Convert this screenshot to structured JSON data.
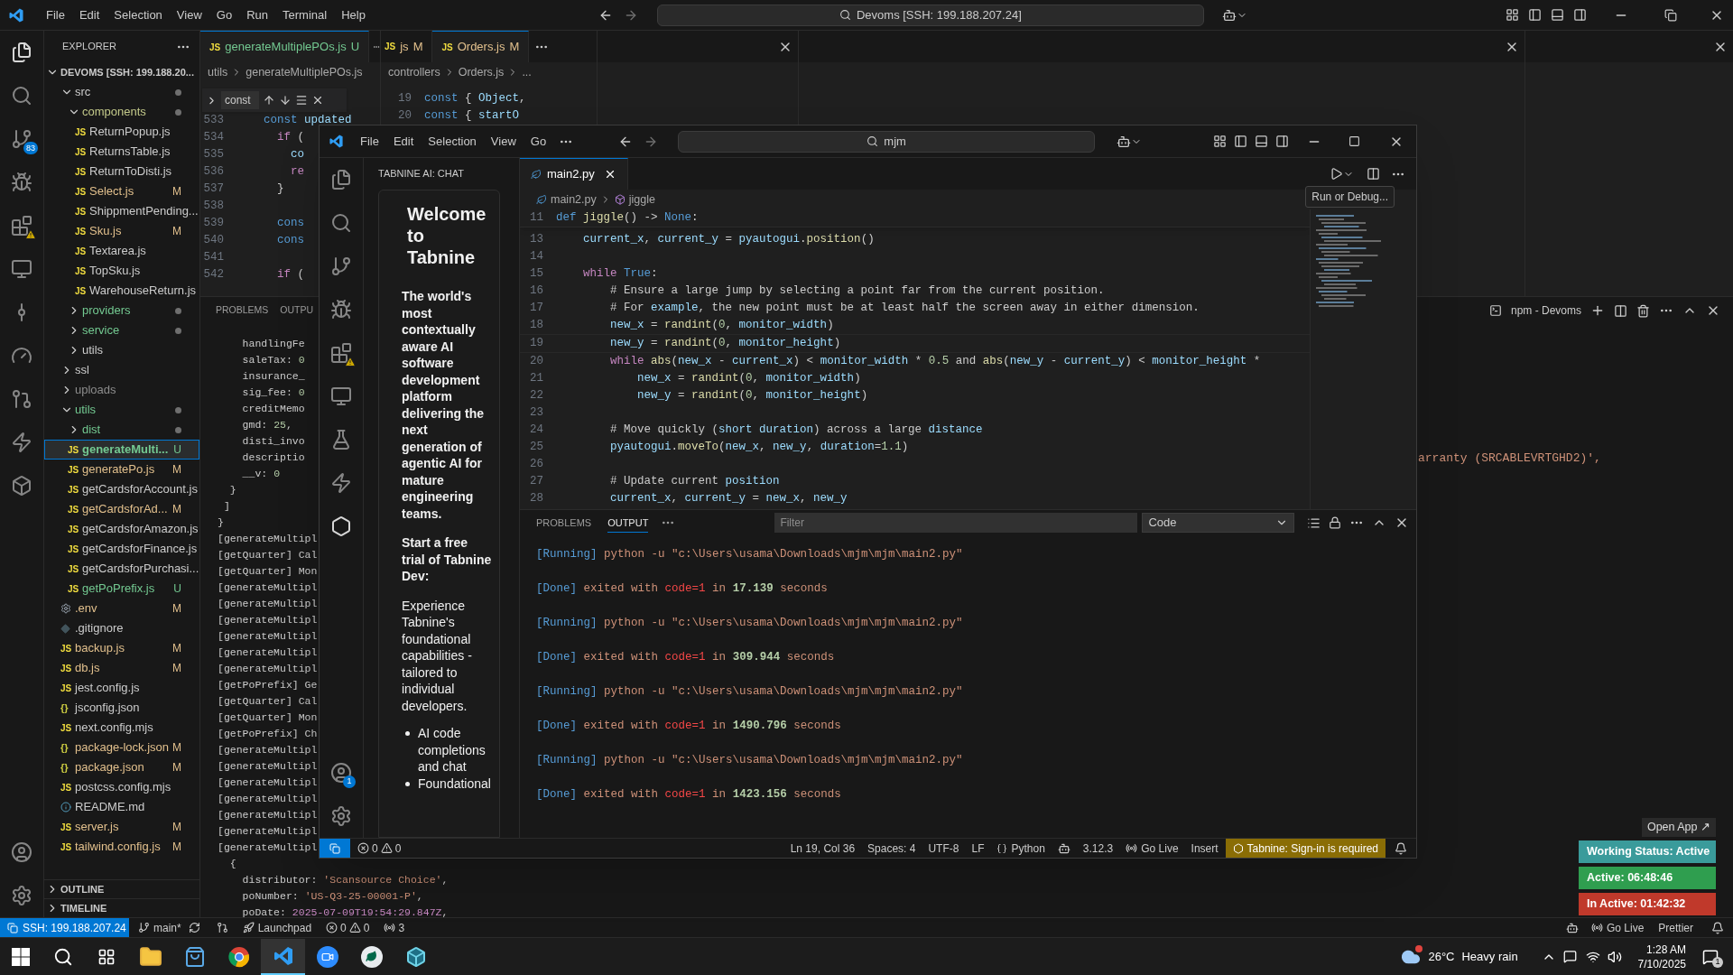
{
  "outer": {
    "menu": [
      "File",
      "Edit",
      "Selection",
      "View",
      "Go",
      "Run",
      "Terminal",
      "Help"
    ],
    "command_center": "Devoms [SSH: 199.188.207.24]",
    "source_control_badge": "83",
    "explorer": {
      "title": "EXPLORER",
      "root": "DEVOMS [SSH: 199.188.20...",
      "tree": [
        {
          "kind": "folder",
          "label": "src",
          "color": "#cccccc",
          "dot": true,
          "expanded": true,
          "selected": false,
          "children": [
            {
              "kind": "folder",
              "label": "components",
              "color": "#c3c98a",
              "dot": true,
              "expanded": true,
              "selected": false,
              "children": [
                {
                  "kind": "js",
                  "glyph": "JS",
                  "label": "ReturnPopup.js",
                  "color": "#cccccc",
                  "selected": false
                },
                {
                  "kind": "js",
                  "glyph": "JS",
                  "label": "ReturnsTable.js",
                  "color": "#cccccc",
                  "selected": false
                },
                {
                  "kind": "js",
                  "glyph": "JS",
                  "label": "ReturnToDisti.js",
                  "color": "#cccccc",
                  "selected": false
                },
                {
                  "kind": "js",
                  "glyph": "JS",
                  "label": "Select.js",
                  "badge": "M",
                  "color": "#e2c08d",
                  "selected": false
                },
                {
                  "kind": "js",
                  "glyph": "JS",
                  "label": "ShippmentPending...",
                  "color": "#cccccc",
                  "selected": false
                },
                {
                  "kind": "js",
                  "glyph": "JS",
                  "label": "Sku.js",
                  "badge": "M",
                  "color": "#e2c08d",
                  "selected": false
                },
                {
                  "kind": "js",
                  "glyph": "JS",
                  "label": "Textarea.js",
                  "color": "#cccccc",
                  "selected": false
                },
                {
                  "kind": "js",
                  "glyph": "JS",
                  "label": "TopSku.js",
                  "color": "#cccccc",
                  "selected": false
                },
                {
                  "kind": "js",
                  "glyph": "JS",
                  "label": "WarehouseReturn.js",
                  "color": "#cccccc",
                  "selected": false
                }
              ]
            },
            {
              "kind": "folder",
              "label": "providers",
              "color": "#73c991",
              "dot": true,
              "expanded": false,
              "selected": false
            },
            {
              "kind": "folder",
              "label": "service",
              "color": "#73c991",
              "dot": true,
              "expanded": false,
              "selected": false
            },
            {
              "kind": "folder",
              "label": "utils",
              "color": "#cccccc",
              "dot": false,
              "expanded": false,
              "selected": false
            }
          ]
        },
        {
          "kind": "folder",
          "label": "ssl",
          "color": "#cccccc",
          "dot": false,
          "expanded": false,
          "selected": false
        },
        {
          "kind": "folder",
          "label": "uploads",
          "color": "#8c8c8c",
          "dot": false,
          "expanded": false,
          "selected": false
        },
        {
          "kind": "folder",
          "label": "utils",
          "color": "#73c991",
          "dot": true,
          "expanded": true,
          "selected": false,
          "children": [
            {
              "kind": "folder",
              "label": "dist",
              "color": "#73c991",
              "dot": true,
              "expanded": false,
              "selected": false
            },
            {
              "kind": "js",
              "glyph": "JS",
              "label": "generateMulti...",
              "badge": "U",
              "color": "#73c991",
              "selected": true
            },
            {
              "kind": "js",
              "glyph": "JS",
              "label": "generatePo.js",
              "badge": "M",
              "color": "#e2c08d",
              "selected": false
            },
            {
              "kind": "js",
              "glyph": "JS",
              "label": "getCardsforAccount.js",
              "color": "#cccccc",
              "selected": false
            },
            {
              "kind": "js",
              "glyph": "JS",
              "label": "getCardsforAd...",
              "badge": "M",
              "color": "#e2c08d",
              "selected": false
            },
            {
              "kind": "js",
              "glyph": "JS",
              "label": "getCardsforAmazon.js",
              "color": "#cccccc",
              "selected": false
            },
            {
              "kind": "js",
              "glyph": "JS",
              "label": "getCardsforFinance.js",
              "color": "#cccccc",
              "selected": false
            },
            {
              "kind": "js",
              "glyph": "JS",
              "label": "getCardsforPurchasi...",
              "color": "#cccccc",
              "selected": false
            },
            {
              "kind": "js",
              "glyph": "JS",
              "label": "getPoPrefix.js",
              "badge": "U",
              "color": "#73c991",
              "selected": false
            }
          ]
        },
        {
          "kind": "env",
          "label": ".env",
          "badge": "M",
          "color": "#e2c08d",
          "selected": false
        },
        {
          "kind": "git",
          "label": ".gitignore",
          "color": "#cccccc",
          "selected": false
        },
        {
          "kind": "js",
          "glyph": "JS",
          "label": "backup.js",
          "badge": "M",
          "color": "#e2c08d",
          "selected": false
        },
        {
          "kind": "js",
          "glyph": "JS",
          "label": "db.js",
          "badge": "M",
          "color": "#e2c08d",
          "selected": false
        },
        {
          "kind": "js",
          "glyph": "JS",
          "label": "jest.config.js",
          "color": "#cccccc",
          "selected": false
        },
        {
          "kind": "json",
          "glyph": "{}",
          "label": "jsconfig.json",
          "color": "#cccccc",
          "selected": false
        },
        {
          "kind": "js",
          "glyph": "JS",
          "label": "next.config.mjs",
          "color": "#cccccc",
          "selected": false
        },
        {
          "kind": "json",
          "glyph": "{}",
          "label": "package-lock.json",
          "badge": "M",
          "color": "#e2c08d",
          "selected": false
        },
        {
          "kind": "json",
          "glyph": "{}",
          "label": "package.json",
          "badge": "M",
          "color": "#e2c08d",
          "selected": false
        },
        {
          "kind": "js",
          "glyph": "JS",
          "label": "postcss.config.mjs",
          "color": "#cccccc",
          "selected": false
        },
        {
          "kind": "readme",
          "label": "README.md",
          "color": "#cccccc",
          "selected": false
        },
        {
          "kind": "js",
          "glyph": "JS",
          "label": "server.js",
          "badge": "M",
          "color": "#e2c08d",
          "selected": false
        },
        {
          "kind": "js",
          "glyph": "JS",
          "label": "tailwind.config.js",
          "badge": "M",
          "color": "#e2c08d",
          "selected": false
        }
      ]
    },
    "outline": "OUTLINE",
    "timeline": "TIMELINE",
    "group1": {
      "tab": {
        "glyph": "JS",
        "label": "generateMultiplePOs.js",
        "badge": "U",
        "selected": true
      },
      "breadcrumbs": [
        "utils",
        "generateMultiplePOs.js"
      ],
      "find": "const",
      "lines": [
        {
          "n": "533",
          "tokens": [
            {
              "text": "    const",
              "kind": "const"
            },
            {
              "text": " updated",
              "kind": "var"
            }
          ]
        },
        {
          "n": "534",
          "tokens": [
            {
              "text": "      if",
              "kind": "kw"
            },
            {
              "text": " (",
              "kind": "plain"
            }
          ]
        },
        {
          "n": "535",
          "tokens": [
            {
              "text": "        co",
              "kind": "var"
            }
          ]
        },
        {
          "n": "536",
          "tokens": [
            {
              "text": "        re",
              "kind": "kw"
            }
          ]
        },
        {
          "n": "537",
          "tokens": [
            {
              "text": "      }",
              "kind": "plain"
            }
          ]
        },
        {
          "n": "538"
        },
        {
          "n": "539",
          "tokens": [
            {
              "text": "      cons",
              "kind": "const"
            }
          ]
        },
        {
          "n": "540",
          "tokens": [
            {
              "text": "      cons",
              "kind": "const"
            }
          ]
        },
        {
          "n": "541"
        },
        {
          "n": "542",
          "tokens": [
            {
              "text": "      if",
              "kind": "kw"
            },
            {
              "text": " (",
              "kind": "plain"
            }
          ]
        }
      ]
    },
    "group2": {
      "tabs": [
        {
          "glyph": "JS",
          "label": "js",
          "badge": "M",
          "selected": false
        },
        {
          "glyph": "JS",
          "label": "Orders.js",
          "badge": "M",
          "selected": true
        }
      ],
      "breadcrumbs": [
        "controllers",
        "Orders.js",
        "..."
      ],
      "lines": [
        {
          "n": "19",
          "tokens": [
            {
              "text": "const",
              "kind": "const"
            },
            {
              "text": " { ",
              "kind": "plain"
            },
            {
              "text": "Object",
              "kind": "var"
            },
            {
              "text": ",",
              "kind": "plain"
            }
          ]
        },
        {
          "n": "20",
          "tokens": [
            {
              "text": "const",
              "kind": "const"
            },
            {
              "text": " { ",
              "kind": "plain"
            },
            {
              "text": "startO",
              "kind": "var"
            }
          ]
        }
      ]
    },
    "panel": {
      "tabs": [
        {
          "label": "PROBLEMS",
          "selected": false
        },
        {
          "label": "OUTPU",
          "selected": false
        }
      ],
      "terminal_name": "npm - Devoms",
      "right_line": "arranty (SRCABLEVRTGHD2)',",
      "lines": [
        [
          {
            "text": "    handlingFe",
            "kind": "plain"
          }
        ],
        [
          {
            "text": "    saleTax: ",
            "kind": "plain"
          },
          {
            "text": "0",
            "kind": "num"
          }
        ],
        [
          {
            "text": "    insurance_",
            "kind": "plain"
          }
        ],
        [
          {
            "text": "    sig_fee: ",
            "kind": "plain"
          },
          {
            "text": "0",
            "kind": "num"
          }
        ],
        [
          {
            "text": "    creditMemo",
            "kind": "plain"
          }
        ],
        [
          {
            "text": "    gmd: ",
            "kind": "plain"
          },
          {
            "text": "25",
            "kind": "num"
          },
          {
            "text": ",",
            "kind": "plain"
          }
        ],
        [
          {
            "text": "    disti_invo",
            "kind": "plain"
          }
        ],
        [
          {
            "text": "    descriptio",
            "kind": "plain"
          }
        ],
        [
          {
            "text": "    __v: ",
            "kind": "plain"
          },
          {
            "text": "0",
            "kind": "num"
          }
        ],
        [
          {
            "text": "  }",
            "kind": "plain"
          }
        ],
        [
          {
            "text": " ]",
            "kind": "plain"
          }
        ],
        [
          {
            "text": "}",
            "kind": "plain"
          }
        ],
        [
          {
            "text": "[generateMultipl",
            "kind": "plain"
          }
        ],
        [
          {
            "text": "[getQuarter] Cal",
            "kind": "plain"
          }
        ],
        [
          {
            "text": "[getQuarter] Mon",
            "kind": "plain"
          }
        ],
        [
          {
            "text": "[generateMultipl",
            "kind": "plain"
          }
        ],
        [
          {
            "text": "[generateMultipl",
            "kind": "plain"
          }
        ],
        [
          {
            "text": "[generateMultipl",
            "kind": "plain"
          }
        ],
        [
          {
            "text": "[generateMultipl",
            "kind": "plain"
          }
        ],
        [
          {
            "text": "[generateMultipl",
            "kind": "plain"
          }
        ],
        [
          {
            "text": "[generateMultipl",
            "kind": "plain"
          }
        ],
        [
          {
            "text": "[getPoPrefix] Ge",
            "kind": "plain"
          }
        ],
        [
          {
            "text": "[getQuarter] Cal",
            "kind": "plain"
          }
        ],
        [
          {
            "text": "[getQuarter] Mon",
            "kind": "plain"
          }
        ],
        [
          {
            "text": "[getPoPrefix] Ch",
            "kind": "plain"
          }
        ],
        [
          {
            "text": "[generateMultipl",
            "kind": "plain"
          }
        ],
        [
          {
            "text": "[generateMultipl",
            "kind": "plain"
          }
        ],
        [
          {
            "text": "[generateMultipl",
            "kind": "plain"
          }
        ],
        [
          {
            "text": "[generateMultipl",
            "kind": "plain"
          }
        ],
        [
          {
            "text": "[generateMultipl",
            "kind": "plain"
          }
        ],
        [
          {
            "text": "[generateMultipl",
            "kind": "plain"
          }
        ],
        [
          {
            "text": "[generateMultipl",
            "kind": "plain"
          }
        ],
        [
          {
            "text": "  {",
            "kind": "plain"
          }
        ],
        [
          {
            "text": "    distributor: ",
            "kind": "plain"
          },
          {
            "text": "'Scansource Choice'",
            "kind": "str"
          },
          {
            "text": ",",
            "kind": "plain"
          }
        ],
        [
          {
            "text": "    poNumber: ",
            "kind": "plain"
          },
          {
            "text": "'US-Q3-25-00001-P'",
            "kind": "str"
          },
          {
            "text": ",",
            "kind": "plain"
          }
        ],
        [
          {
            "text": "    poDate: ",
            "kind": "plain"
          },
          {
            "text": "2025-07-09T19:54:29.847Z",
            "kind": "date"
          },
          {
            "text": ",",
            "kind": "plain"
          }
        ]
      ]
    },
    "status_bar": {
      "remote": "SSH: 199.188.207.24",
      "branch": "main*",
      "launchpad": "Launchpad",
      "errors": "0",
      "warnings": "0",
      "ports": "3",
      "go_live": "Go Live",
      "prettier": "Prettier"
    }
  },
  "inner": {
    "menu": [
      "File",
      "Edit",
      "Selection",
      "View",
      "Go"
    ],
    "command_center": "mjm",
    "accounts_badge": "1",
    "chat": {
      "title": "TABNINE AI: CHAT",
      "heading": "Welcome to Tabnine",
      "intro": "The world's most contextually aware AI software development platform delivering the next generation of agentic AI for mature engineering teams.",
      "cta": "Start a free trial of Tabnine Dev:",
      "body": "Experience Tabnine's foundational capabilities - tailored to individual developers.",
      "bullets": [
        "AI code completions and chat",
        "Foundational"
      ]
    },
    "tab": {
      "label": "main2.py",
      "selected": true
    },
    "breadcrumbs": [
      "main2.py",
      "jiggle"
    ],
    "tooltip": "Run or Debug...",
    "sticky": {
      "n": "11",
      "tokens": [
        {
          "text": "def ",
          "kind": "const"
        },
        {
          "text": "jiggle",
          "kind": "func"
        },
        {
          "text": "() -> ",
          "kind": "plain"
        },
        {
          "text": "None",
          "kind": "const"
        },
        {
          "text": ":",
          "kind": "plain"
        }
      ]
    },
    "lines": [
      {
        "n": "13",
        "current": false,
        "tokens": [
          {
            "text": "    current_x",
            "kind": "var"
          },
          {
            "text": ", ",
            "kind": "plain"
          },
          {
            "text": "current_y",
            "kind": "var"
          },
          {
            "text": " = ",
            "kind": "plain"
          },
          {
            "text": "pyautogui",
            "kind": "var"
          },
          {
            "text": ".",
            "kind": "plain"
          },
          {
            "text": "position",
            "kind": "func"
          },
          {
            "text": "()",
            "kind": "plain"
          }
        ]
      },
      {
        "n": "14",
        "current": false
      },
      {
        "n": "15",
        "current": false,
        "tokens": [
          {
            "text": "    while ",
            "kind": "kw"
          },
          {
            "text": "True",
            "kind": "const"
          },
          {
            "text": ":",
            "kind": "plain"
          }
        ]
      },
      {
        "n": "16",
        "current": false,
        "tokens": [
          {
            "text": "        # Ensure a large jump by selecting a point far from the current position.",
            "kind": "plain"
          }
        ]
      },
      {
        "n": "17",
        "current": false,
        "tokens": [
          {
            "text": "        # For ",
            "kind": "plain"
          },
          {
            "text": "example",
            "kind": "var"
          },
          {
            "text": ", the new point must be at least half the screen away in either dimension.",
            "kind": "plain"
          }
        ]
      },
      {
        "n": "18",
        "current": false,
        "tokens": [
          {
            "text": "        new_x",
            "kind": "var"
          },
          {
            "text": " = ",
            "kind": "plain"
          },
          {
            "text": "randint",
            "kind": "func"
          },
          {
            "text": "(",
            "kind": "plain"
          },
          {
            "text": "0",
            "kind": "num"
          },
          {
            "text": ", ",
            "kind": "plain"
          },
          {
            "text": "monitor_width",
            "kind": "var"
          },
          {
            "text": ")",
            "kind": "plain"
          }
        ]
      },
      {
        "n": "19",
        "current": true,
        "tokens": [
          {
            "text": "        new_y",
            "kind": "var"
          },
          {
            "text": " = ",
            "kind": "plain"
          },
          {
            "text": "randint",
            "kind": "func"
          },
          {
            "text": "(",
            "kind": "plain"
          },
          {
            "text": "0",
            "kind": "num"
          },
          {
            "text": ", ",
            "kind": "plain"
          },
          {
            "text": "monitor_height",
            "kind": "var"
          },
          {
            "text": ")",
            "kind": "plain"
          }
        ]
      },
      {
        "n": "20",
        "current": false,
        "tokens": [
          {
            "text": "        while ",
            "kind": "kw"
          },
          {
            "text": "abs",
            "kind": "func"
          },
          {
            "text": "(",
            "kind": "plain"
          },
          {
            "text": "new_x",
            "kind": "var"
          },
          {
            "text": " - ",
            "kind": "plain"
          },
          {
            "text": "current_x",
            "kind": "var"
          },
          {
            "text": ") < ",
            "kind": "plain"
          },
          {
            "text": "monitor_width",
            "kind": "var"
          },
          {
            "text": " * ",
            "kind": "plain"
          },
          {
            "text": "0.5",
            "kind": "num"
          },
          {
            "text": " and ",
            "kind": "plain"
          },
          {
            "text": "abs",
            "kind": "func"
          },
          {
            "text": "(",
            "kind": "plain"
          },
          {
            "text": "new_y",
            "kind": "var"
          },
          {
            "text": " - ",
            "kind": "plain"
          },
          {
            "text": "current_y",
            "kind": "var"
          },
          {
            "text": ") < ",
            "kind": "plain"
          },
          {
            "text": "monitor_height",
            "kind": "var"
          },
          {
            "text": " *",
            "kind": "plain"
          }
        ]
      },
      {
        "n": "21",
        "current": false,
        "tokens": [
          {
            "text": "            new_x",
            "kind": "var"
          },
          {
            "text": " = ",
            "kind": "plain"
          },
          {
            "text": "randint",
            "kind": "func"
          },
          {
            "text": "(",
            "kind": "plain"
          },
          {
            "text": "0",
            "kind": "num"
          },
          {
            "text": ", ",
            "kind": "plain"
          },
          {
            "text": "monitor_width",
            "kind": "var"
          },
          {
            "text": ")",
            "kind": "plain"
          }
        ]
      },
      {
        "n": "22",
        "current": false,
        "tokens": [
          {
            "text": "            new_y",
            "kind": "var"
          },
          {
            "text": " = ",
            "kind": "plain"
          },
          {
            "text": "randint",
            "kind": "func"
          },
          {
            "text": "(",
            "kind": "plain"
          },
          {
            "text": "0",
            "kind": "num"
          },
          {
            "text": ", ",
            "kind": "plain"
          },
          {
            "text": "monitor_height",
            "kind": "var"
          },
          {
            "text": ")",
            "kind": "plain"
          }
        ]
      },
      {
        "n": "23",
        "current": false
      },
      {
        "n": "24",
        "current": false,
        "tokens": [
          {
            "text": "        # Move quickly (",
            "kind": "plain"
          },
          {
            "text": "short duration",
            "kind": "var"
          },
          {
            "text": ") across a large ",
            "kind": "plain"
          },
          {
            "text": "distance",
            "kind": "var"
          }
        ]
      },
      {
        "n": "25",
        "current": false,
        "tokens": [
          {
            "text": "        pyautogui",
            "kind": "var"
          },
          {
            "text": ".",
            "kind": "plain"
          },
          {
            "text": "moveTo",
            "kind": "func"
          },
          {
            "text": "(",
            "kind": "plain"
          },
          {
            "text": "new_x",
            "kind": "var"
          },
          {
            "text": ", ",
            "kind": "plain"
          },
          {
            "text": "new_y",
            "kind": "var"
          },
          {
            "text": ", ",
            "kind": "plain"
          },
          {
            "text": "duration",
            "kind": "var"
          },
          {
            "text": "=",
            "kind": "plain"
          },
          {
            "text": "1.1",
            "kind": "num"
          },
          {
            "text": ")",
            "kind": "plain"
          }
        ]
      },
      {
        "n": "26",
        "current": false
      },
      {
        "n": "27",
        "current": false,
        "tokens": [
          {
            "text": "        # Update current ",
            "kind": "plain"
          },
          {
            "text": "position",
            "kind": "var"
          }
        ]
      },
      {
        "n": "28",
        "current": false,
        "tokens": [
          {
            "text": "        current_x",
            "kind": "var"
          },
          {
            "text": ", ",
            "kind": "plain"
          },
          {
            "text": "current_y",
            "kind": "var"
          },
          {
            "text": " = ",
            "kind": "plain"
          },
          {
            "text": "new_x",
            "kind": "var"
          },
          {
            "text": ", ",
            "kind": "plain"
          },
          {
            "text": "new_y",
            "kind": "var"
          }
        ]
      }
    ],
    "panel": {
      "tabs": [
        {
          "label": "PROBLEMS",
          "selected": false
        },
        {
          "label": "OUTPUT",
          "selected": true
        }
      ],
      "filter_placeholder": "Filter",
      "channel": "Code",
      "output": [
        {
          "kind": "running",
          "tag": "[Running]",
          "command": "python -u \"c:\\Users\\usama\\Downloads\\mjm\\mjm\\main2.py\""
        },
        {
          "kind": "done",
          "tag": "[Done]",
          "text": "exited with",
          "code": "code=1",
          "in": "in",
          "duration": "17.139",
          "unit": "seconds"
        },
        {
          "kind": "running",
          "tag": "[Running]",
          "command": "python -u \"c:\\Users\\usama\\Downloads\\mjm\\mjm\\main2.py\""
        },
        {
          "kind": "done",
          "tag": "[Done]",
          "text": "exited with",
          "code": "code=1",
          "in": "in",
          "duration": "309.944",
          "unit": "seconds"
        },
        {
          "kind": "running",
          "tag": "[Running]",
          "command": "python -u \"c:\\Users\\usama\\Downloads\\mjm\\mjm\\main2.py\""
        },
        {
          "kind": "done",
          "tag": "[Done]",
          "text": "exited with",
          "code": "code=1",
          "in": "in",
          "duration": "1490.796",
          "unit": "seconds"
        },
        {
          "kind": "running",
          "tag": "[Running]",
          "command": "python -u \"c:\\Users\\usama\\Downloads\\mjm\\mjm\\main2.py\""
        },
        {
          "kind": "done",
          "tag": "[Done]",
          "text": "exited with",
          "code": "code=1",
          "in": "in",
          "duration": "1423.156",
          "unit": "seconds"
        }
      ]
    },
    "status_bar": {
      "errors": "0",
      "warnings": "0",
      "position": "Ln 19, Col 36",
      "spaces": "Spaces: 4",
      "encoding": "UTF-8",
      "eol": "LF",
      "language": "Python",
      "python_version": "3.12.3",
      "go_live": "Go Live",
      "mode": "Insert",
      "tabnine": "Tabnine: Sign-in is required"
    }
  },
  "widgets": {
    "open_app": "Open App ↗",
    "working": "Working Status: Active",
    "active": "Active: 06:48:46",
    "inactive": "In Active: 01:42:32"
  },
  "taskbar": {
    "apps": [
      {
        "kind": "files",
        "selected": false
      },
      {
        "kind": "store",
        "selected": false
      },
      {
        "kind": "browser",
        "selected": false
      },
      {
        "kind": "editor",
        "selected": true
      },
      {
        "kind": "meeting",
        "selected": false
      },
      {
        "kind": "database",
        "selected": false
      },
      {
        "kind": "cube",
        "selected": false
      }
    ],
    "temperature": "26°C",
    "weather": "Heavy rain",
    "time": "1:28 AM",
    "date": "7/10/2025",
    "notifications": "1"
  }
}
